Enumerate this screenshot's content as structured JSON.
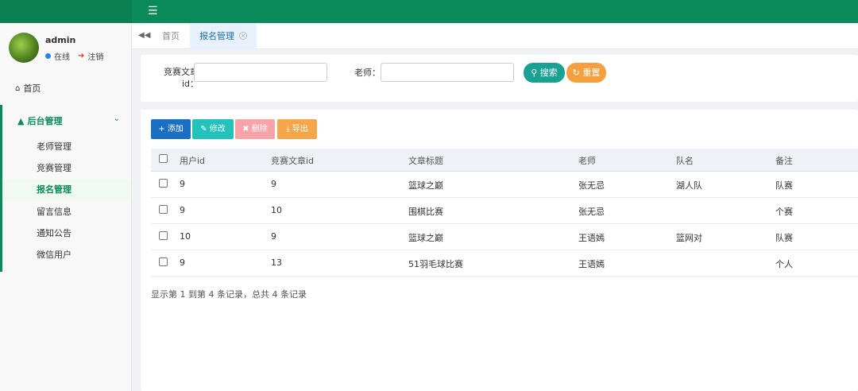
{
  "topbar": {
    "menu_icon": "hamburger-icon"
  },
  "user": {
    "name": "admin",
    "status": "在线",
    "logout": "注销"
  },
  "nav": {
    "home": "首页",
    "group_title": "后台管理",
    "items": [
      {
        "label": "老师管理"
      },
      {
        "label": "竞赛管理"
      },
      {
        "label": "报名管理"
      },
      {
        "label": "留言信息"
      },
      {
        "label": "通知公告"
      },
      {
        "label": "微信用户"
      }
    ]
  },
  "tabs": {
    "home": "首页",
    "active": "报名管理"
  },
  "search": {
    "article_label": "竞赛文章id：",
    "article_value": "",
    "teacher_label": "老师：",
    "teacher_value": "",
    "search_btn": "搜索",
    "reset_btn": "重置"
  },
  "toolbar": {
    "add": "添加",
    "edit": "修改",
    "delete": "删除",
    "export": "导出"
  },
  "table": {
    "headers": [
      "用户id",
      "竞赛文章id",
      "文章标题",
      "老师",
      "队名",
      "备注"
    ],
    "rows": [
      [
        "9",
        "9",
        "篮球之巅",
        "张无忌",
        "湖人队",
        "队赛"
      ],
      [
        "9",
        "10",
        "围棋比赛",
        "张无忌",
        "",
        "个赛"
      ],
      [
        "10",
        "9",
        "篮球之巅",
        "王语嫣",
        "篮网对",
        "队赛"
      ],
      [
        "9",
        "13",
        "51羽毛球比赛",
        "王语嫣",
        "",
        "个人"
      ]
    ]
  },
  "pagination": {
    "summary": "显示第 1 到第 4 条记录，总共 4 条记录"
  },
  "colors": {
    "brand": "#0a8a5a",
    "search": "#1aa194",
    "reset": "#f5a040",
    "add": "#1a6fc0",
    "edit": "#22c1bb",
    "delete": "#f6a3a9",
    "export": "#f5a64b"
  }
}
